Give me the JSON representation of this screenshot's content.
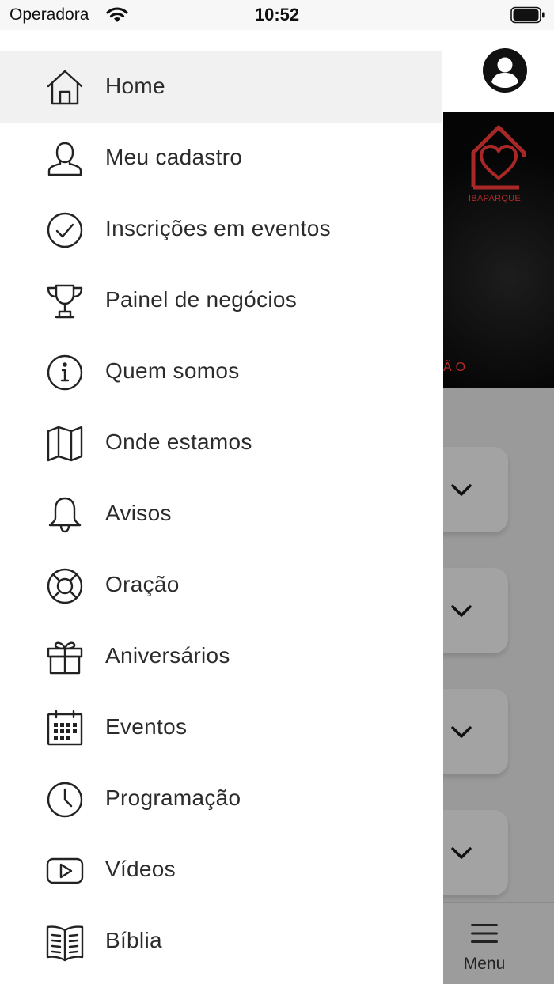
{
  "status_bar": {
    "carrier": "Operadora",
    "time": "10:52"
  },
  "drawer": {
    "items": [
      {
        "label": "Home",
        "icon": "home-icon"
      },
      {
        "label": "Meu cadastro",
        "icon": "user-icon"
      },
      {
        "label": "Inscrições em eventos",
        "icon": "check-circle-icon"
      },
      {
        "label": "Painel de negócios",
        "icon": "trophy-icon"
      },
      {
        "label": "Quem somos",
        "icon": "info-icon"
      },
      {
        "label": "Onde estamos",
        "icon": "map-icon"
      },
      {
        "label": "Avisos",
        "icon": "bell-icon"
      },
      {
        "label": "Oração",
        "icon": "lifebuoy-icon"
      },
      {
        "label": "Aniversários",
        "icon": "gift-icon"
      },
      {
        "label": "Eventos",
        "icon": "calendar-icon"
      },
      {
        "label": "Programação",
        "icon": "clock-icon"
      },
      {
        "label": "Vídeos",
        "icon": "video-icon"
      },
      {
        "label": "Bíblia",
        "icon": "book-icon"
      }
    ],
    "active_index": 0
  },
  "background": {
    "logo_text": "IBAPARQUE",
    "hero_tag": "ÃO",
    "tab_menu_label": "Menu",
    "accent_color": "#b52a2a"
  }
}
